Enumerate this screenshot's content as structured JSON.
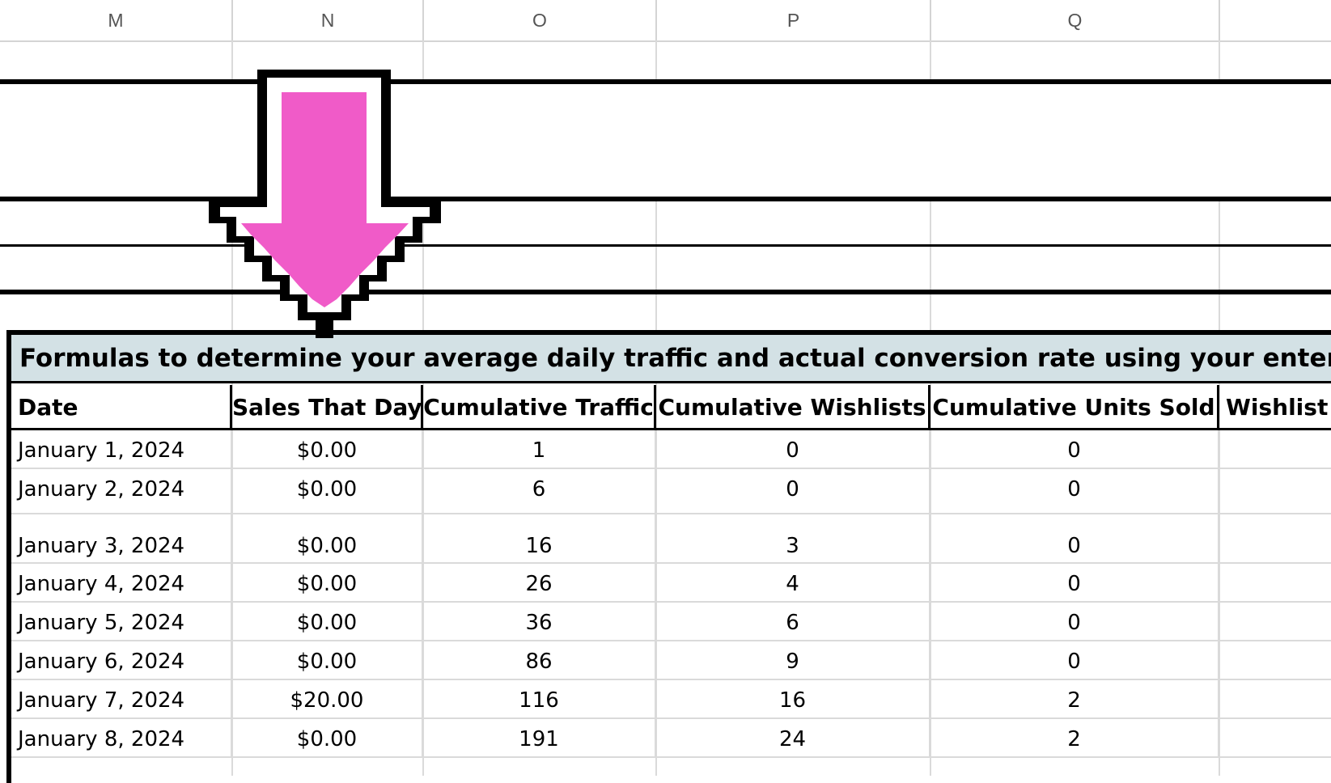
{
  "columns": [
    "M",
    "N",
    "O",
    "P",
    "Q"
  ],
  "title": "Formulas to determine your average daily traffic and actual conversion rate using your enter",
  "headers": [
    "Date",
    "Sales That Day",
    "Cumulative Traffic",
    "Cumulative Wishlists",
    "Cumulative Units Sold",
    "Wishlist"
  ],
  "rows": [
    {
      "date": "January 1, 2024",
      "sales": "$0.00",
      "traffic": "1",
      "wishlists": "0",
      "units": "0"
    },
    {
      "date": "January 2, 2024",
      "sales": "$0.00",
      "traffic": "6",
      "wishlists": "0",
      "units": "0"
    },
    {
      "date": "January 3, 2024",
      "sales": "$0.00",
      "traffic": "16",
      "wishlists": "3",
      "units": "0"
    },
    {
      "date": "January 4, 2024",
      "sales": "$0.00",
      "traffic": "26",
      "wishlists": "4",
      "units": "0"
    },
    {
      "date": "January 5, 2024",
      "sales": "$0.00",
      "traffic": "36",
      "wishlists": "6",
      "units": "0"
    },
    {
      "date": "January 6, 2024",
      "sales": "$0.00",
      "traffic": "86",
      "wishlists": "9",
      "units": "0"
    },
    {
      "date": "January 7, 2024",
      "sales": "$20.00",
      "traffic": "116",
      "wishlists": "16",
      "units": "2"
    },
    {
      "date": "January 8, 2024",
      "sales": "$0.00",
      "traffic": "191",
      "wishlists": "24",
      "units": "2"
    }
  ],
  "arrow": {
    "icon": "down-arrow-icon",
    "fill_color": "#f05bc8"
  },
  "colors": {
    "title_band": "#d3e1e5",
    "grid_line": "#dadada"
  }
}
